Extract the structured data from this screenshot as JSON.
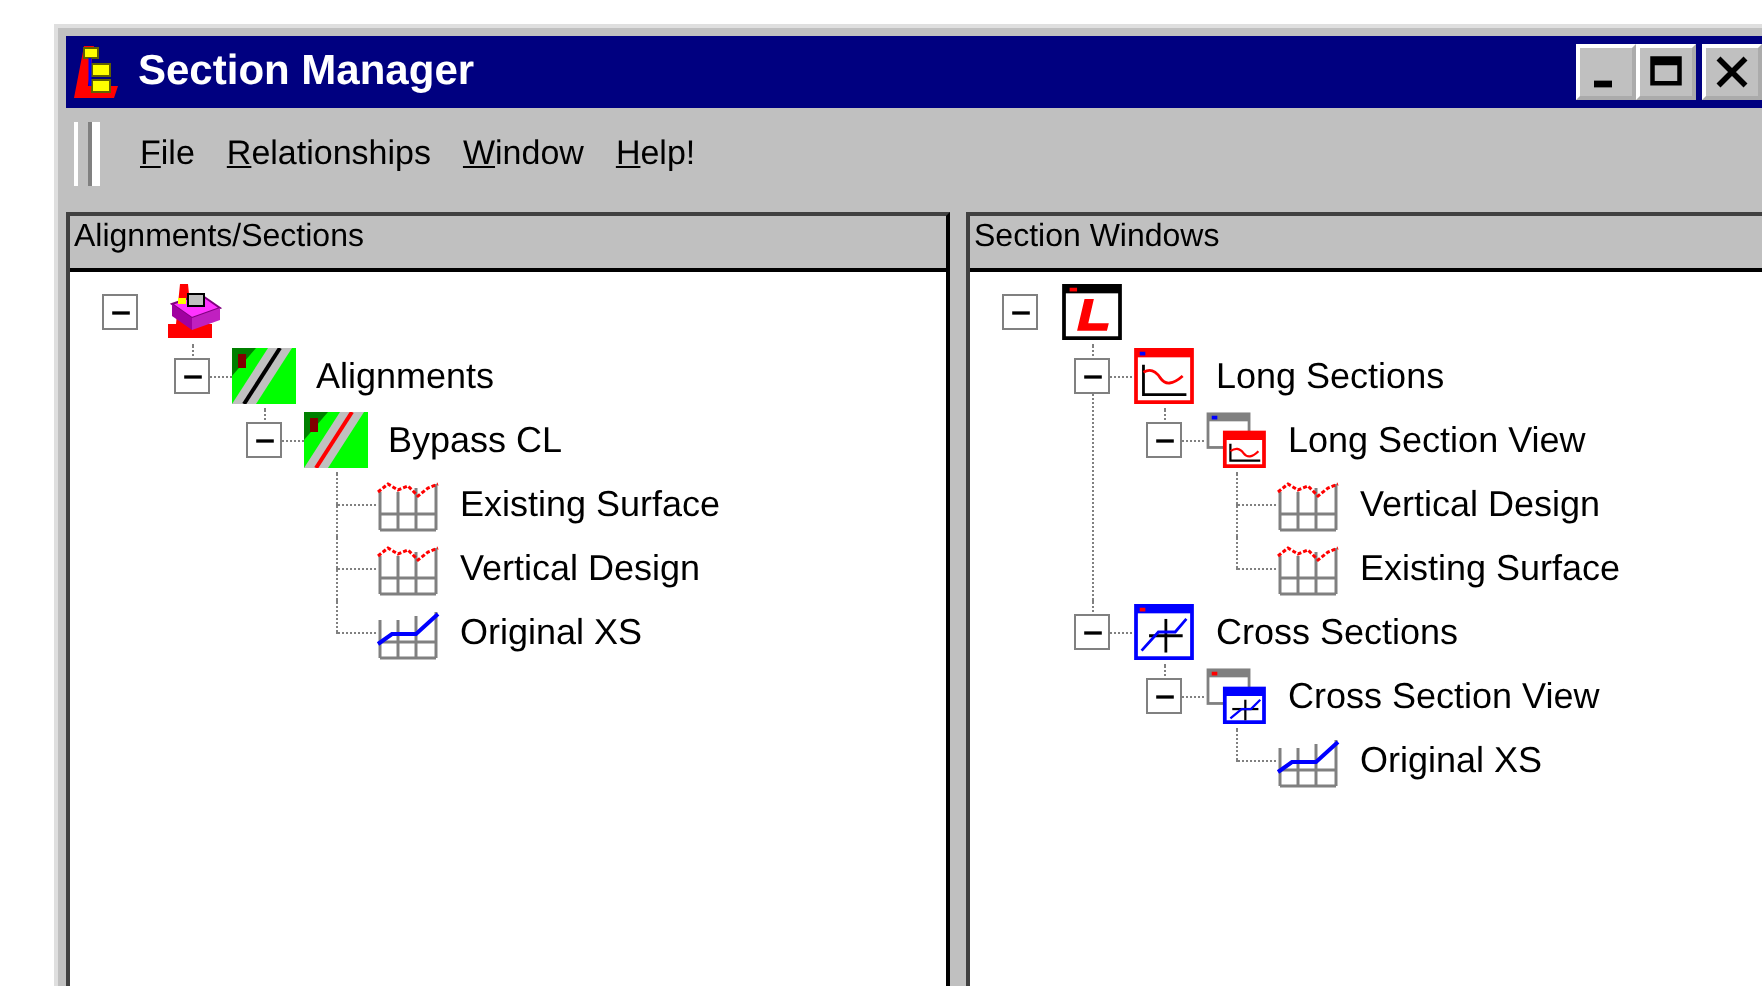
{
  "window": {
    "title": "Section Manager"
  },
  "menu": [
    {
      "label": "File"
    },
    {
      "label": "Relationships"
    },
    {
      "label": "Window"
    },
    {
      "label": "Help!"
    }
  ],
  "panels": [
    {
      "title": "Alignments/Sections",
      "tree": [
        {
          "kind": "project",
          "expanded": true,
          "children": [
            {
              "kind": "alignment-group",
              "label": "Alignments",
              "expanded": true,
              "children": [
                {
                  "kind": "alignment",
                  "label": "Bypass CL",
                  "expanded": true,
                  "children": [
                    {
                      "kind": "profile",
                      "label": "Existing Surface"
                    },
                    {
                      "kind": "profile",
                      "label": "Vertical Design"
                    },
                    {
                      "kind": "cross-section",
                      "label": "Original XS"
                    }
                  ]
                }
              ]
            }
          ]
        }
      ]
    },
    {
      "title": "Section Windows",
      "tree": [
        {
          "kind": "section-root",
          "expanded": true,
          "children": [
            {
              "kind": "long-sections",
              "label": "Long Sections",
              "expanded": true,
              "children": [
                {
                  "kind": "long-view",
                  "label": "Long Section View",
                  "expanded": true,
                  "children": [
                    {
                      "kind": "profile",
                      "label": "Vertical Design"
                    },
                    {
                      "kind": "profile",
                      "label": "Existing Surface"
                    }
                  ]
                }
              ]
            },
            {
              "kind": "cross-sections",
              "label": "Cross Sections",
              "expanded": true,
              "children": [
                {
                  "kind": "cross-view",
                  "label": "Cross Section View",
                  "expanded": true,
                  "children": [
                    {
                      "kind": "cross-section",
                      "label": "Original XS"
                    }
                  ]
                }
              ]
            }
          ]
        }
      ]
    }
  ]
}
